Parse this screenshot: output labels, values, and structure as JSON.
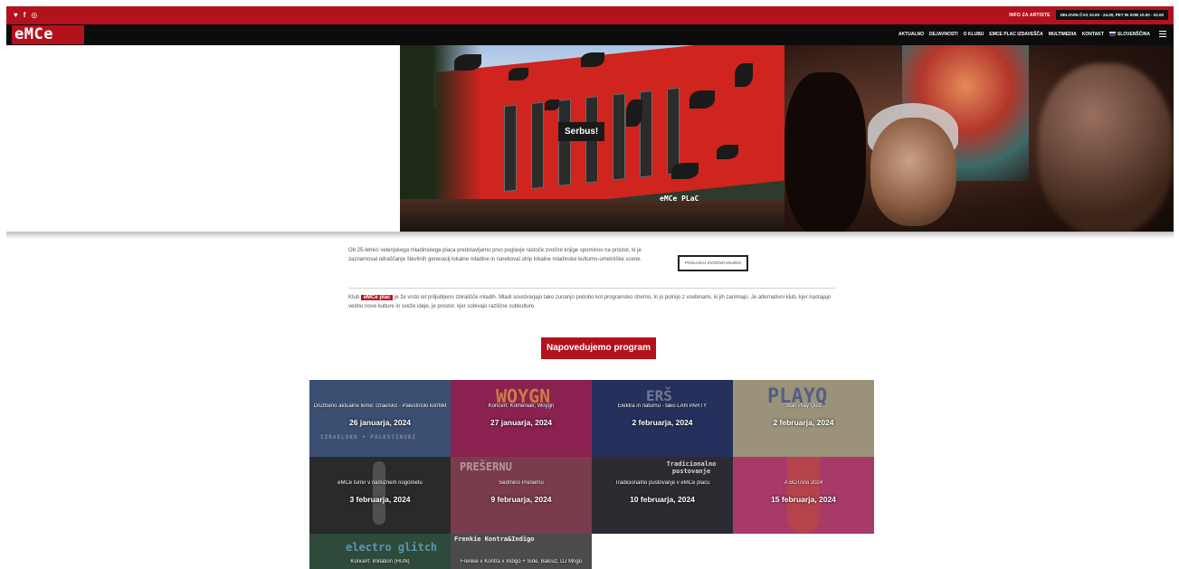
{
  "topbar": {
    "social": [
      "♥",
      "f",
      "◎"
    ],
    "artist_info": "INFO ZA ARTISTE",
    "hours": "DELOVNI ČAS 10.00 - 24.00, PET IN SOB 10.00 - 02.00"
  },
  "nav": {
    "logo": "eMCe PLaC",
    "items": [
      "AKTUALNO",
      "DEJAVNOSTI",
      "O KLUBU",
      "EMCE PLAC IZDAVEŠČA",
      "MULTIMEDIA",
      "KONTAKT"
    ],
    "language": "SLOVENŠČINA"
  },
  "hero": {
    "caption": "Serbus!",
    "building_sign": "eMCe PLaC"
  },
  "intro": {
    "text": "Ob 25-letnici velenjskega mladinskega placa predstavljamo prvo poglavje rastoče zvočne knjige spominov na prostor, ki je zaznamoval odraščanje številnih generacij lokalne mladine in narekoval utrip lokalne mladinske kulturno-umetniške scene.",
    "button": "POSLUŠAJ ZVOČNO KNJIGO"
  },
  "club": {
    "prefix": "Klub",
    "badge": "eMCe plac",
    "text": "je že vrsto let priljubljeno zbirališče mladih. Mladi soustvarjajo tako zunanjo podobo kot programsko shemo, ki jo polnijo z vsebinami, ki jih zanimajo. Je alternativni klub, kjer nastajajo vedno nove kulture in sveže ideje, je prostor, kjer sobivajo različne subkulture."
  },
  "program_button": "Napovedujemo program",
  "events": [
    {
      "title": "Družbeno aktualne teme: Izraelsko - Palestinski konflikt",
      "date": "26 januarja, 2024",
      "art": "IZRAELSKO • PALESTINSKI",
      "bg": "#3b4f73"
    },
    {
      "title": "Koncert: Komeniak; Woygn",
      "date": "27 januarja, 2024",
      "art": "WOYGN",
      "bg": "#8a2150"
    },
    {
      "title": "Elektra in naturnu - tako LAN PARTY",
      "date": "2 februarja, 2024",
      "art": "ERŠ",
      "bg": "#26305c"
    },
    {
      "title": "Stari Play Quiz",
      "date": "2 februarja, 2024",
      "art": "PLAYQ",
      "bg": "#9a9379"
    },
    {
      "title": "eMCe turnir v namiznem nogometu",
      "date": "3 februarja, 2024",
      "art": "",
      "bg": "#2a2a2a"
    },
    {
      "title": "Sedmino Prešernu",
      "date": "9 februarja, 2024",
      "art": "PREŠERNU",
      "bg": "#7a3c4c"
    },
    {
      "title": "Tradicionalno pustovanje v eMCe placu",
      "date": "10 februarja, 2024",
      "art": "Tradicionalno pustovanje",
      "bg": "#2d2a32"
    },
    {
      "title": "A BOTrino 2024",
      "date": "15 februarja, 2024",
      "art": "",
      "bg": "#a83a6a"
    },
    {
      "title": "Koncert: Imitation (HUN)",
      "date": "",
      "art": "electro glitch",
      "bg": "#2e4a3a"
    },
    {
      "title": "Frenkie x Kontra x Indigo + Side, Balcuz, DJ Mrigo",
      "date": "",
      "art": "Frenkie Kontra&Indigo",
      "bg": "#4b4b4b"
    }
  ]
}
